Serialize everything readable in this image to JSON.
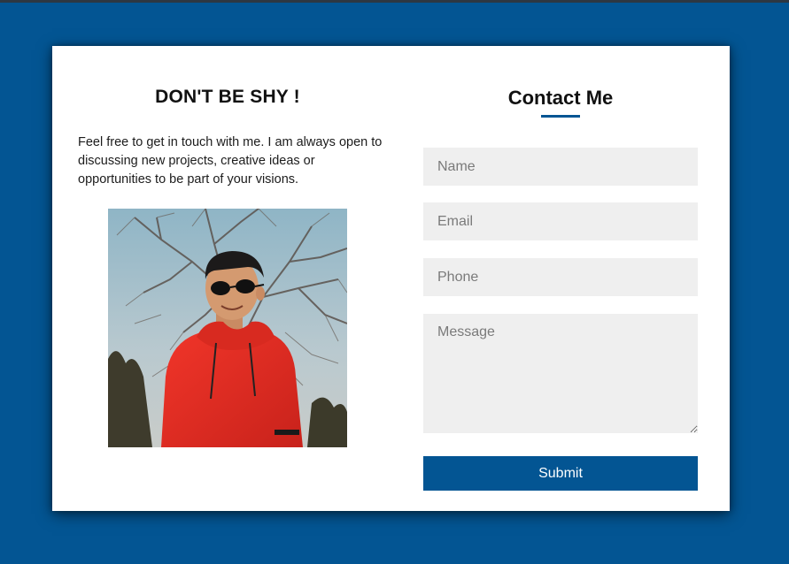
{
  "colors": {
    "page_background": "#035593",
    "card_background": "#ffffff",
    "accent": "#035593",
    "input_background": "#efefef"
  },
  "left": {
    "title": "DON'T BE SHY !",
    "intro": "Feel free to get in touch with me. I am always open to discussing new projects, creative ideas or opportunities to be part of your visions."
  },
  "right": {
    "title": "Contact Me"
  },
  "form": {
    "name_placeholder": "Name",
    "email_placeholder": "Email",
    "phone_placeholder": "Phone",
    "message_placeholder": "Message",
    "submit_label": "Submit"
  },
  "photo": {
    "icon": "portrait-photo"
  }
}
